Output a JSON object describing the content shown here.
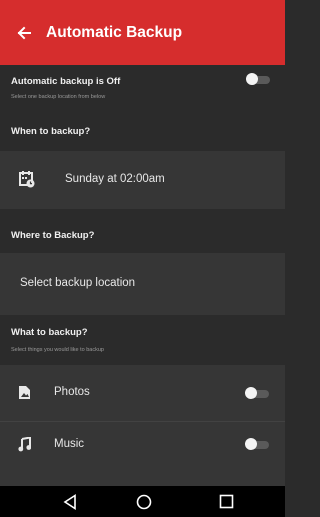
{
  "appbar": {
    "title": "Automatic Backup"
  },
  "auto_backup": {
    "label": "Automatic backup is Off",
    "sublabel": "Select one backup location from below",
    "enabled": false
  },
  "when": {
    "title": "When to backup?",
    "schedule": "Sunday at 02:00am"
  },
  "where": {
    "title": "Where to Backup?",
    "location": "Select backup location"
  },
  "what": {
    "title": "What to backup?",
    "sublabel": "Select things you would like to backup",
    "items": [
      {
        "label": "Photos",
        "enabled": false,
        "icon": "photo-icon"
      },
      {
        "label": "Music",
        "enabled": false,
        "icon": "music-icon"
      }
    ]
  },
  "colors": {
    "appbar": "#d62d2d",
    "background": "#2b2b2b",
    "row_background": "#363636"
  }
}
